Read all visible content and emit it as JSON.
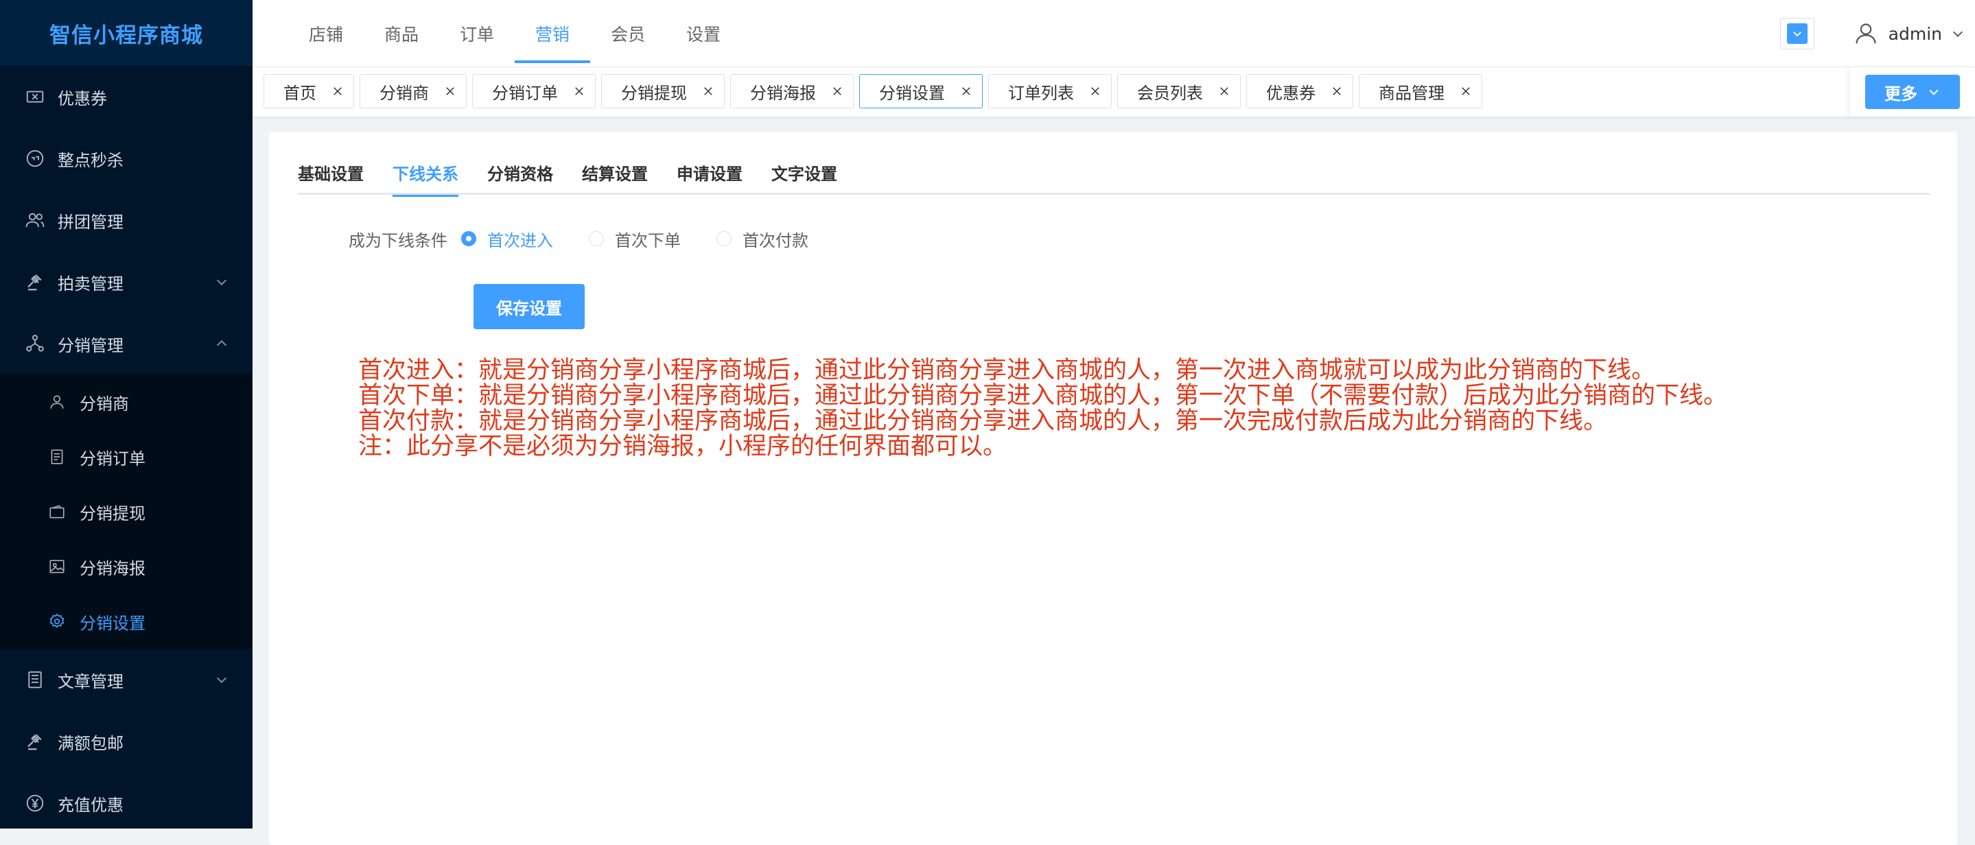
{
  "brand": "智信小程序商城",
  "sidebar": {
    "items": [
      {
        "label": "优惠券",
        "icon": "coupon-icon"
      },
      {
        "label": "整点秒杀",
        "icon": "flash-sale-icon"
      },
      {
        "label": "拼团管理",
        "icon": "group-icon"
      },
      {
        "label": "拍卖管理",
        "icon": "auction-icon"
      },
      {
        "label": "分销管理",
        "icon": "distribution-icon"
      }
    ],
    "submenu": [
      {
        "label": "分销商",
        "icon": "user-icon"
      },
      {
        "label": "分销订单",
        "icon": "document-icon"
      },
      {
        "label": "分销提现",
        "icon": "wallet-icon"
      },
      {
        "label": "分销海报",
        "icon": "image-icon"
      },
      {
        "label": "分销设置",
        "icon": "gear-icon"
      }
    ],
    "bottom": [
      {
        "label": "文章管理",
        "icon": "article-icon"
      },
      {
        "label": "满额包邮",
        "icon": "shipping-icon"
      },
      {
        "label": "充值优惠",
        "icon": "yen-icon"
      }
    ]
  },
  "topnav": [
    "店铺",
    "商品",
    "订单",
    "营销",
    "会员",
    "设置"
  ],
  "user": {
    "name": "admin"
  },
  "tags": [
    "首页",
    "分销商",
    "分销订单",
    "分销提现",
    "分销海报",
    "分销设置",
    "订单列表",
    "会员列表",
    "优惠券",
    "商品管理"
  ],
  "more_label": "更多",
  "subtabs": [
    "基础设置",
    "下线关系",
    "分销资格",
    "结算设置",
    "申请设置",
    "文字设置"
  ],
  "form": {
    "label": "成为下线条件",
    "options": [
      "首次进入",
      "首次下单",
      "首次付款"
    ],
    "selected": "首次进入",
    "save_label": "保存设置"
  },
  "notes": [
    "首次进入：就是分销商分享小程序商城后，通过此分销商分享进入商城的人，第一次进入商城就可以成为此分销商的下线。",
    "首次下单：就是分销商分享小程序商城后，通过此分销商分享进入商城的人，第一次下单（不需要付款）后成为此分销商的下线。",
    "首次付款：就是分销商分享小程序商城后，通过此分销商分享进入商城的人，第一次完成付款后成为此分销商的下线。",
    "注：此分享不是必须为分销海报，小程序的任何界面都可以。"
  ],
  "colors": {
    "accent": "#409eff",
    "sidebar_bg": "#001529",
    "note_red": "#e03b1b"
  }
}
